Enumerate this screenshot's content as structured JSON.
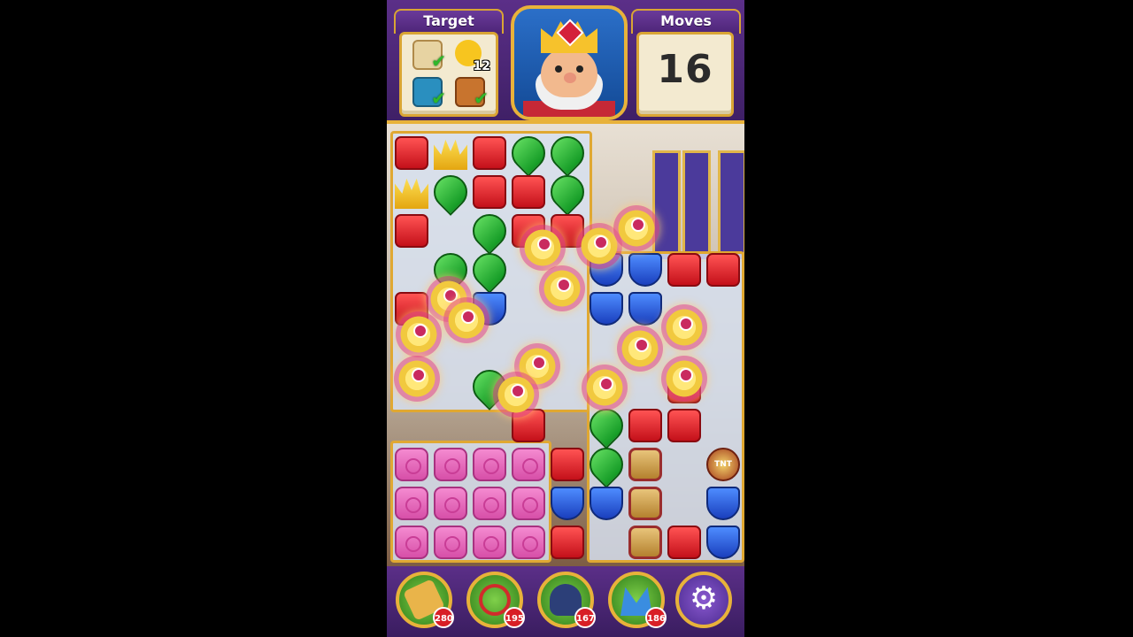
{
  "header": {
    "target_label": "Target",
    "moves_label": "Moves",
    "moves_value": "16",
    "goals": [
      {
        "icon": "scroll-icon",
        "done": true
      },
      {
        "icon": "duck-icon",
        "count": "12",
        "done": false
      },
      {
        "icon": "jar-icon",
        "done": true
      },
      {
        "icon": "box-icon",
        "done": true
      }
    ],
    "avatar": "king-avatar"
  },
  "boosters": [
    {
      "icon": "hammer-icon",
      "count": "280"
    },
    {
      "icon": "arrow-icon",
      "count": "195"
    },
    {
      "icon": "cannon-icon",
      "count": "167"
    },
    {
      "icon": "jester-hat-icon",
      "count": "186"
    }
  ],
  "settings": {
    "icon": "gear-icon",
    "glyph": "⚙"
  },
  "colors": {
    "red": "#e02a2a",
    "blue": "#2f5fe0",
    "green": "#1fb033",
    "yellow": "#f4c21e",
    "pink": "#e46bbd",
    "frame": "#e8b23a"
  }
}
